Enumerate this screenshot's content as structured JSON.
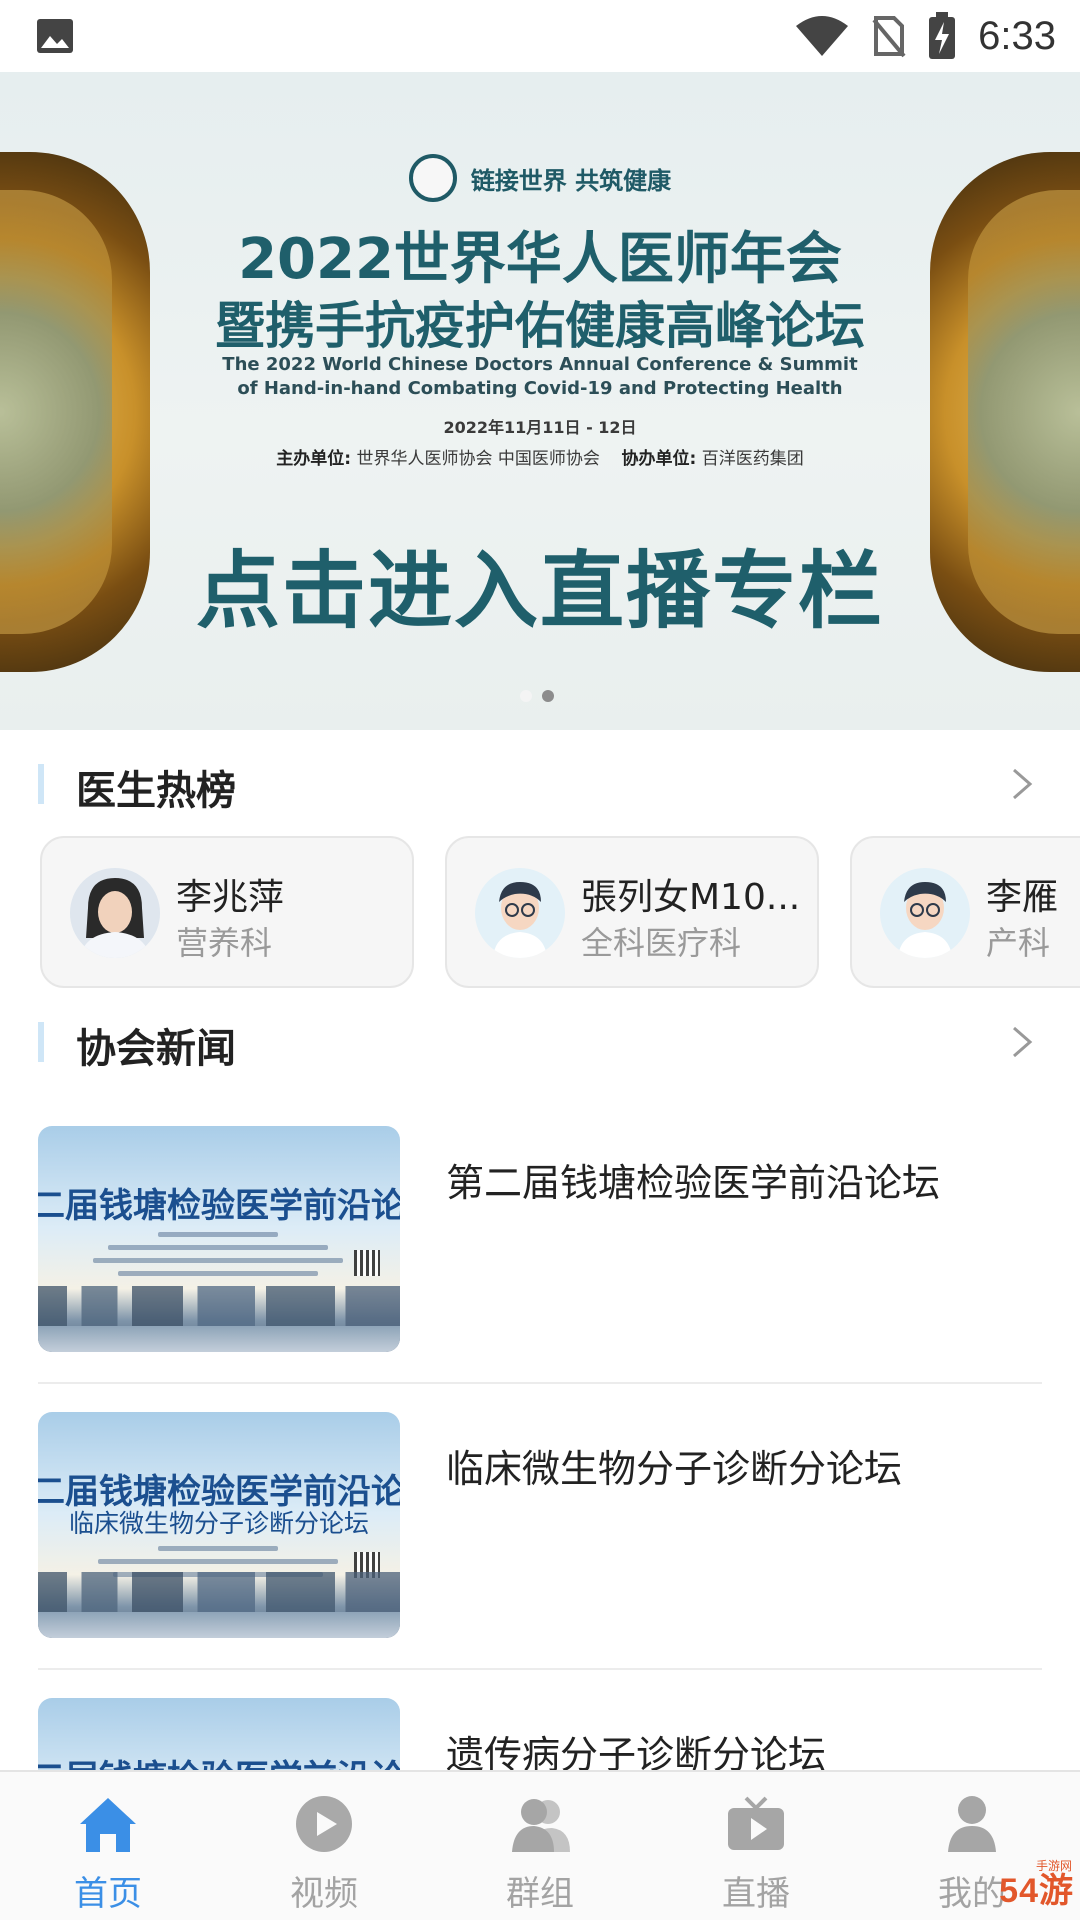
{
  "status_bar": {
    "time": "6:33",
    "icons": [
      "image-icon",
      "wifi-icon",
      "no-sim-icon",
      "battery-charging-icon"
    ]
  },
  "banner": {
    "tagline": "链接世界 共筑健康",
    "title_line1": "2022世界华人医师年会",
    "title_line2": "暨携手抗疫护佑健康高峰论坛",
    "english_line1": "The 2022 World Chinese Doctors Annual Conference & Summit",
    "english_line2": "of Hand-in-hand Combating Covid-19 and Protecting Health",
    "date": "2022年11月11日 - 12日",
    "host_label": "主办单位:",
    "host_value": "世界华人医师协会   中国医师协会",
    "co_label": "协办单位:",
    "co_value": "百洋医药集团",
    "cta": "点击进入直播专栏",
    "slide_count": 2,
    "active_slide": 2
  },
  "doctors_section": {
    "title": "医生热榜",
    "doctors": [
      {
        "name": "李兆萍",
        "department": "营养科",
        "avatar": "photo"
      },
      {
        "name": "張列女M10...",
        "department": "全科医疗科",
        "avatar": "cartoon-doctor"
      },
      {
        "name": "李雁",
        "department": "产科",
        "avatar": "cartoon-doctor"
      }
    ]
  },
  "news_section": {
    "title": "协会新闻",
    "items": [
      {
        "title": "第二届钱塘检验医学前沿论坛",
        "thumb_title": "二届钱塘检验医学前沿论",
        "thumb_sub": ""
      },
      {
        "title": "临床微生物分子诊断分论坛",
        "thumb_title": "二届钱塘检验医学前沿论",
        "thumb_sub": "临床微生物分子诊断分论坛"
      },
      {
        "title": "遗传病分子诊断分论坛",
        "thumb_title": "二届钱塘检验医学前沿论",
        "thumb_sub": ""
      }
    ]
  },
  "bottom_nav": {
    "items": [
      {
        "label": "首页",
        "icon": "home-icon",
        "active": true
      },
      {
        "label": "视频",
        "icon": "video-play-icon",
        "active": false
      },
      {
        "label": "群组",
        "icon": "group-icon",
        "active": false
      },
      {
        "label": "直播",
        "icon": "live-tv-icon",
        "active": false
      },
      {
        "label": "我的",
        "icon": "profile-icon",
        "active": false
      }
    ]
  },
  "watermark": {
    "text": "54游",
    "url": "手游网"
  },
  "colors": {
    "accent": "#3b8fe6",
    "banner_text": "#1f5f6b",
    "section_bar": "#cfe6f7"
  }
}
